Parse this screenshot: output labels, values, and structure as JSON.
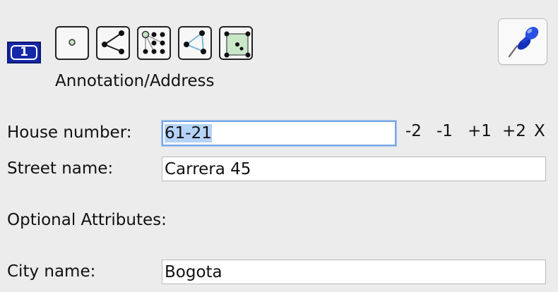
{
  "step_badge": "1",
  "preset_icons": [
    "node-icon",
    "way-icon",
    "multipolygon-icon",
    "closed-way-icon",
    "area-icon"
  ],
  "preset_name": "Annotation/Address",
  "fields": {
    "house_number": {
      "label": "House number:",
      "value": "61-21"
    },
    "street_name": {
      "label": "Street name:",
      "value": "Carrera 45"
    },
    "optional_header": "Optional Attributes:",
    "city_name": {
      "label": "City name:",
      "value": "Bogota"
    }
  },
  "increment_buttons": [
    "-2",
    "-1",
    "+1",
    "+2",
    "X"
  ],
  "colors": {
    "badge": "#1428a8",
    "pin": "#1e3fd0",
    "focus": "#76a5e5",
    "area_fill": "#c8e8c8"
  }
}
